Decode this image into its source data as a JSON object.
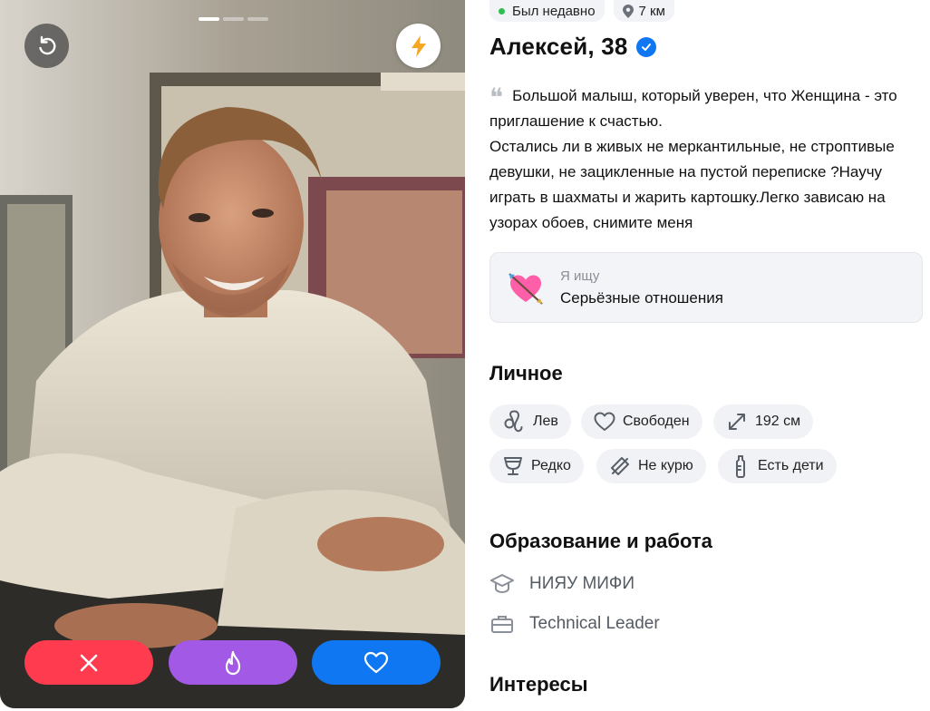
{
  "photo": {
    "pages": 3,
    "active_page": 1
  },
  "status": {
    "online_text": "Был недавно",
    "distance": "7 км"
  },
  "profile": {
    "name": "Алексей, 38",
    "verified": true
  },
  "bio": {
    "lines": [
      "Большой малыш, который уверен, что Женщина - это приглашение к счастью.",
      "Остались ли в живых не меркантильные, не строптивые девушки, не зацикленные на пустой переписке ?Научу играть в шахматы и жарить картошку.Легко зависаю на узорах обоев, снимите меня"
    ]
  },
  "seeking": {
    "label": "Я ищу",
    "value": "Серьёзные отношения",
    "emoji": "heart-with-arrow"
  },
  "personal": {
    "title": "Личное",
    "chips": [
      {
        "icon": "leo-icon",
        "label": "Лев"
      },
      {
        "icon": "heart-outline-icon",
        "label": "Свободен"
      },
      {
        "icon": "height-icon",
        "label": "192 см"
      },
      {
        "icon": "glass-icon",
        "label": "Редко"
      },
      {
        "icon": "no-smoking-icon",
        "label": "Не курю"
      },
      {
        "icon": "baby-bottle-icon",
        "label": "Есть дети"
      }
    ]
  },
  "education": {
    "title": "Образование и работа",
    "school": "НИЯУ МИФИ",
    "job": "Technical Leader"
  },
  "interests": {
    "title": "Интересы"
  },
  "colors": {
    "dislike": "#ff3b4f",
    "superlike": "#a259e6",
    "like": "#1077f2",
    "verified": "#1077f2",
    "online": "#2fbf4f",
    "boost": "#f5a623"
  }
}
